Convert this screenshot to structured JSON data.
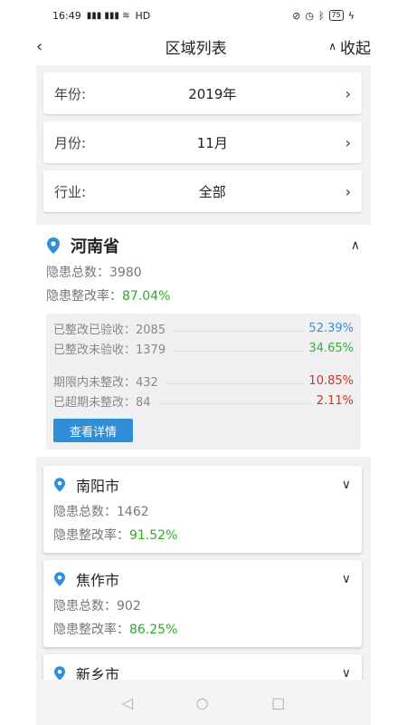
{
  "status_bar": {
    "time": "16:49",
    "signal": "4G 4G",
    "network": "HD",
    "battery": "75"
  },
  "nav": {
    "back": "‹",
    "title": "区域列表",
    "collapse_label": "收起"
  },
  "filters": [
    {
      "label": "年份:",
      "value": "2019年"
    },
    {
      "label": "月份:",
      "value": "11月"
    },
    {
      "label": "行业:",
      "value": "全部"
    }
  ],
  "province": {
    "name": "河南省",
    "total_label": "隐患总数：",
    "total_value": "3980",
    "rate_label": "隐患整改率：",
    "rate_value": "87.04%",
    "details": [
      {
        "label": "已整改已验收：",
        "value": "2085",
        "pct": "52.39%",
        "color": "#3a8fd4"
      },
      {
        "label": "已整改未验收：",
        "value": "1379",
        "pct": "34.65%",
        "color": "#3caa3c"
      },
      {
        "label": "期限内未整改：",
        "value": "432",
        "pct": "10.85%",
        "color": "#c0392b"
      },
      {
        "label": "已超期未整改：",
        "value": "84",
        "pct": "2.11%",
        "color": "#c0392b"
      }
    ],
    "detail_button": "查看详情"
  },
  "cities": [
    {
      "name": "南阳市",
      "total_label": "隐患总数：",
      "total_value": "1462",
      "rate_label": "隐患整改率：",
      "rate_value": "91.52%"
    },
    {
      "name": "焦作市",
      "total_label": "隐患总数：",
      "total_value": "902",
      "rate_label": "隐患整改率：",
      "rate_value": "86.25%"
    },
    {
      "name": "新乡市"
    }
  ],
  "colors": {
    "accent": "#2e8fd6",
    "green": "#2fa82f",
    "pin": "#2e8fd6"
  },
  "icons": {
    "back": "back-arrow-icon",
    "collapse": "chevron-up-icon",
    "filter_arrow": "chevron-right-icon",
    "pin": "location-pin-icon",
    "expand": "chevron-down-icon"
  }
}
